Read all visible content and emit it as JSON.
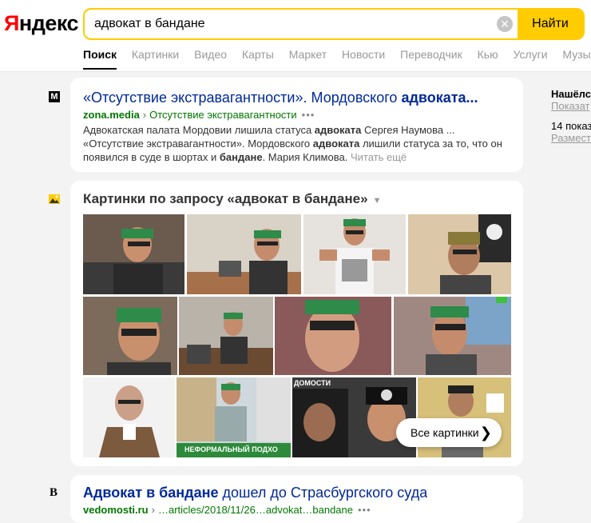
{
  "header": {
    "logo_first": "Я",
    "logo_rest": "ндекс",
    "search_value": "адвокат в бандане",
    "search_button": "Найти",
    "clear_icon": "close-icon",
    "accent": "#ffcc00",
    "tabs": [
      "Поиск",
      "Картинки",
      "Видео",
      "Карты",
      "Маркет",
      "Новости",
      "Переводчик",
      "Кью",
      "Услуги",
      "Музыка"
    ]
  },
  "results": [
    {
      "favicon": "M",
      "title_plain": "«Отсутствие экстравагантности». Мордовского ",
      "title_bold": "адвоката...",
      "domain": "zona.media",
      "path": "Отсутствие экстравагантности",
      "snippet_1": "Адвокатская палата Мордовии лишила статуса ",
      "snippet_1b": "адвоката",
      "snippet_1c": " Сергея Наумова ...",
      "snippet_2": "«Отсутствие экстравагантности». Мордовского ",
      "snippet_2b": "адвоката",
      "snippet_2c": " лишили статуса за то, что он",
      "snippet_3": "появился в суде в шортах и ",
      "snippet_3b": "бандане",
      "snippet_3c": ". Мария Климова.",
      "more": "Читать ещё"
    },
    {
      "favicon": "B",
      "title_bold": "Адвокат в бандане",
      "title_plain": " дошел до Страсбургского суда",
      "domain": "vedomosti.ru",
      "path": "…articles/2018/11/26…advokat…bandane"
    }
  ],
  "images": {
    "title": "Картинки по запросу «адвокат в бандане»",
    "all_button": "Все картинки",
    "banner_text": "НЕФОРМАЛЬНЫЙ ПОДХО",
    "caption_top": "ДОМОСТИ"
  },
  "sidebar": {
    "line1": "Нашёлс",
    "line2": "Показат",
    "line3": "14 показ",
    "line4": "Размест"
  }
}
